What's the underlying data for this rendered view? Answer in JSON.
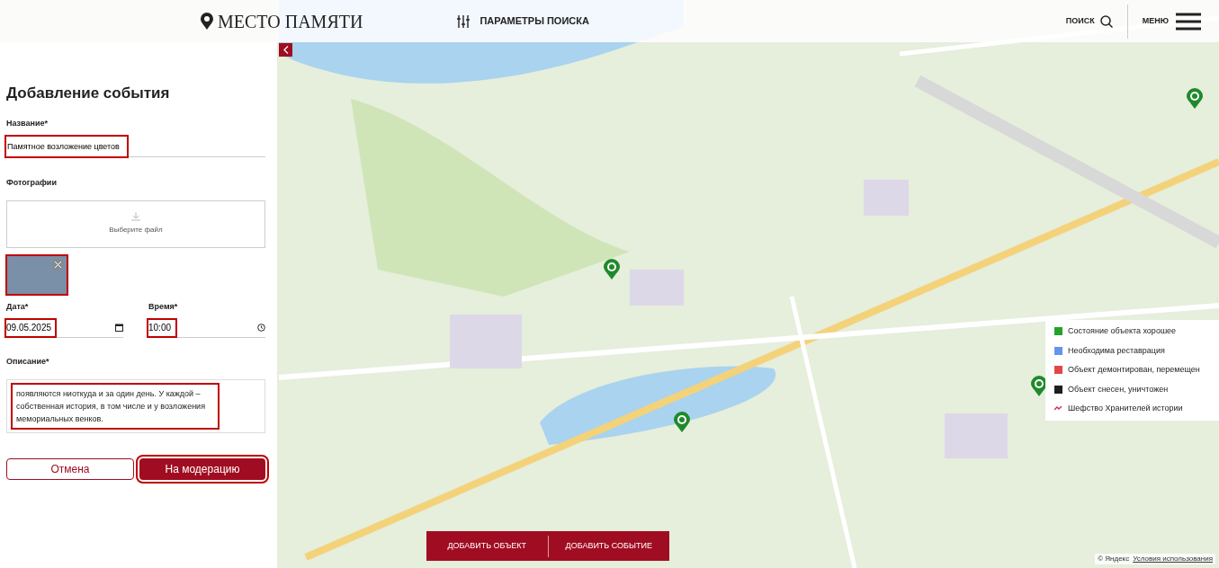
{
  "header": {
    "logo": "МЕСТО ПАМЯТИ",
    "search_params": "ПАРАМЕТРЫ ПОИСКА",
    "search": "ПОИСК",
    "menu": "МЕНЮ"
  },
  "form": {
    "title": "Добавление события",
    "name": {
      "label": "Название*",
      "value": "Памятное возложение цветов",
      "highlighted": true
    },
    "photos": {
      "label": "Фотографии",
      "upload": "Выберите файл",
      "thumb_highlighted": true
    },
    "date": {
      "label": "Дата*",
      "value": "09.05.2025",
      "highlighted": true
    },
    "time": {
      "label": "Время*",
      "value": "10:00",
      "highlighted": true
    },
    "description": {
      "label": "Описание*",
      "value": "появляются ниоткуда и за один день. У каждой – собственная история, в том числе и у возложения мемориальных венков.",
      "highlighted": true
    },
    "buttons": [
      {
        "label": "Отмена",
        "kind": "secondary",
        "highlighted": false
      },
      {
        "label": "На модерацию",
        "kind": "primary",
        "highlighted": true
      }
    ]
  },
  "legend": [
    {
      "kind": "square",
      "color": "#22a32a",
      "label": "Состояние объекта хорошее"
    },
    {
      "kind": "square",
      "color": "#6495ed",
      "label": "Необходима реставрация"
    },
    {
      "kind": "square",
      "color": "#e04848",
      "label": "Объект демонтирован, перемещен"
    },
    {
      "kind": "square",
      "color": "#1e1e1e",
      "label": "Объект снесен, уничтожен"
    },
    {
      "kind": "mark",
      "color": "#c0304a",
      "label": "Шефство Хранителей истории"
    }
  ],
  "map_actions": [
    "ДОБАВИТЬ ОБЪЕКТ",
    "ДОБАВИТЬ СОБЫТИЕ"
  ],
  "attribution": {
    "copyright": "© Яндекс",
    "terms": "Условия использования"
  }
}
